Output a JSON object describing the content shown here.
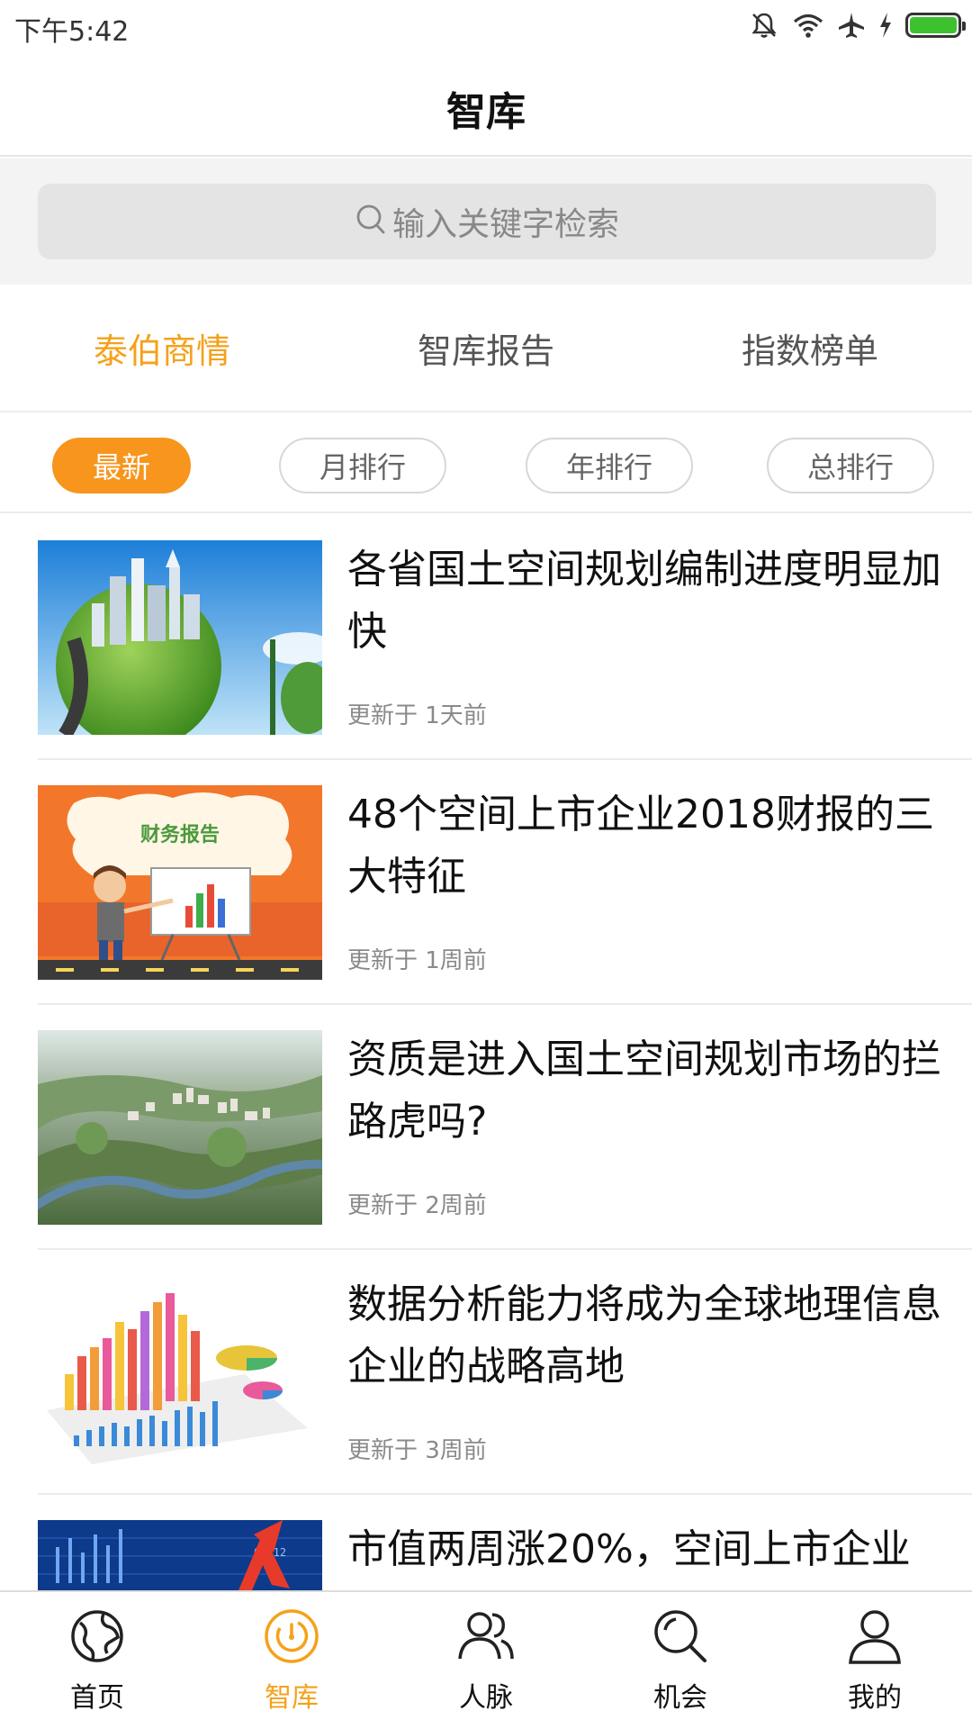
{
  "status_bar": {
    "time": "下午5:42",
    "icons": [
      "mute-icon",
      "wifi-icon",
      "airplane-icon",
      "charging-icon",
      "battery-icon"
    ],
    "battery_level": 1.0,
    "battery_color": "#3ec12f"
  },
  "header": {
    "title": "智库"
  },
  "search": {
    "placeholder": "输入关键字检索"
  },
  "category_tabs": [
    {
      "label": "泰伯商情",
      "active": true
    },
    {
      "label": "智库报告",
      "active": false
    },
    {
      "label": "指数榜单",
      "active": false
    }
  ],
  "filters": [
    {
      "label": "最新",
      "active": true
    },
    {
      "label": "月排行",
      "active": false
    },
    {
      "label": "年排行",
      "active": false
    },
    {
      "label": "总排行",
      "active": false
    }
  ],
  "articles": [
    {
      "title": "各省国土空间规划编制进度明显加快",
      "updated": "更新于 1天前",
      "thumb": "green-globe-city"
    },
    {
      "title": "48个空间上市企业2018财报的三大特征",
      "updated": "更新于 1周前",
      "thumb": "financial-report-cartoon",
      "thumb_text": "财务报告"
    },
    {
      "title": "资质是进入国土空间规划市场的拦路虎吗?",
      "updated": "更新于 2周前",
      "thumb": "aerial-city-rendering"
    },
    {
      "title": "数据分析能力将成为全球地理信息企业的战略高地",
      "updated": "更新于 3周前",
      "thumb": "3d-bar-charts"
    },
    {
      "title": "市值两周涨20%，空间上市企业",
      "updated": "",
      "thumb": "stock-chart-arrow"
    }
  ],
  "bottom_nav": [
    {
      "label": "首页",
      "icon": "globe-icon",
      "active": false
    },
    {
      "label": "智库",
      "icon": "dial-icon",
      "active": true
    },
    {
      "label": "人脉",
      "icon": "people-icon",
      "active": false
    },
    {
      "label": "机会",
      "icon": "search-icon",
      "active": false
    },
    {
      "label": "我的",
      "icon": "user-icon",
      "active": false
    }
  ],
  "colors": {
    "accent": "#f5a11a",
    "pill_active": "#f7951d"
  }
}
